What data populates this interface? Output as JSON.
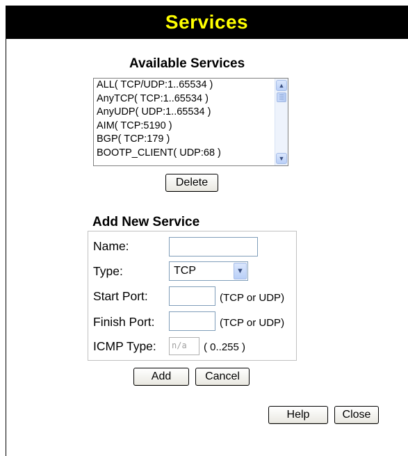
{
  "header": {
    "title": "Services"
  },
  "available": {
    "title": "Available Services",
    "items": [
      "ALL( TCP/UDP:1..65534 )",
      "AnyTCP( TCP:1..65534 )",
      "AnyUDP( UDP:1..65534 )",
      "AIM( TCP:5190 )",
      "BGP( TCP:179 )",
      "BOOTP_CLIENT( UDP:68 )"
    ],
    "delete_label": "Delete"
  },
  "add_service": {
    "title": "Add New Service",
    "name_label": "Name:",
    "name_value": "",
    "type_label": "Type:",
    "type_value": "TCP",
    "start_port_label": "Start Port:",
    "start_port_value": "",
    "start_port_note": "(TCP or UDP)",
    "finish_port_label": "Finish Port:",
    "finish_port_value": "",
    "finish_port_note": "(TCP or UDP)",
    "icmp_type_label": "ICMP Type:",
    "icmp_type_value": "n/a",
    "icmp_type_note": "( 0..255 )",
    "add_label": "Add",
    "cancel_label": "Cancel"
  },
  "footer": {
    "help_label": "Help",
    "close_label": "Close"
  }
}
